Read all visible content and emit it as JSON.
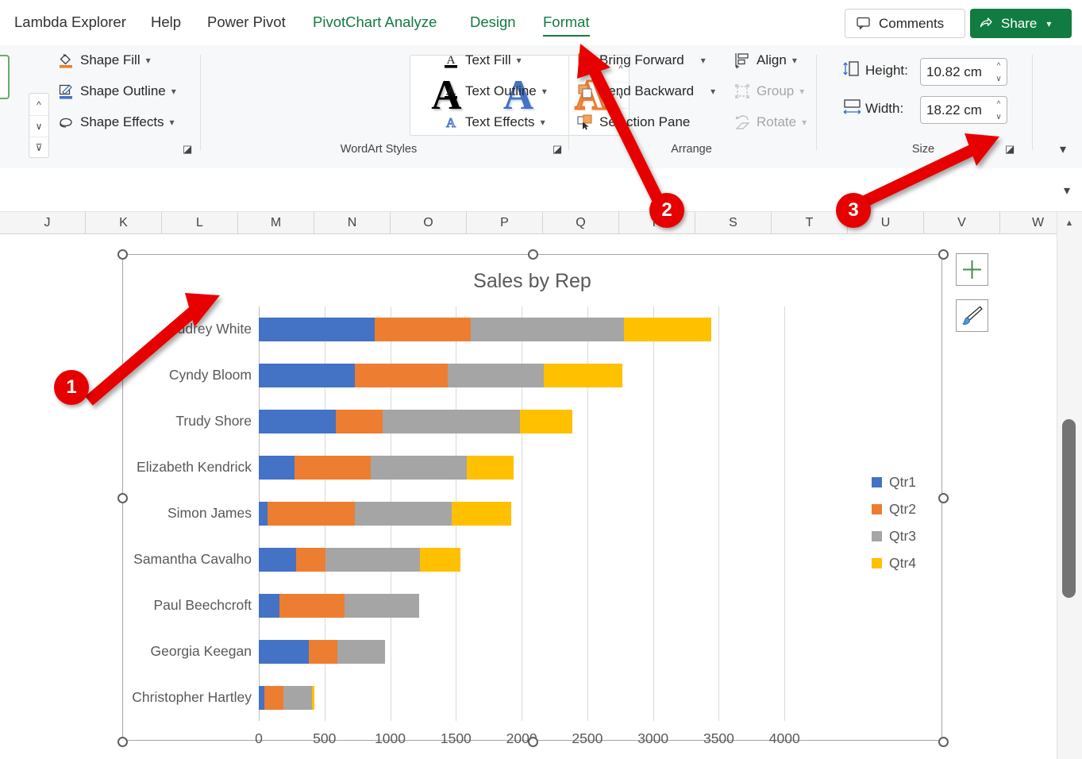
{
  "ribbon": {
    "tabs": [
      {
        "label": "Lambda Explorer",
        "style": "dark"
      },
      {
        "label": "Help",
        "style": "dark"
      },
      {
        "label": "Power Pivot",
        "style": "dark"
      },
      {
        "label": "PivotChart Analyze",
        "style": "green"
      },
      {
        "label": "Design",
        "style": "green"
      },
      {
        "label": "Format",
        "style": "active"
      }
    ],
    "comments_label": "Comments",
    "share_label": "Share",
    "groups": {
      "shape_styles": {
        "items": [
          {
            "label": "Shape Fill",
            "icon": "paint-bucket-icon",
            "chevron": "ˇ",
            "disabled": false
          },
          {
            "label": "Shape Outline",
            "icon": "pen-outline-icon",
            "chevron": "ˇ",
            "disabled": false
          },
          {
            "label": "Shape Effects",
            "icon": "shape-effects-icon",
            "chevron": "ˇ",
            "disabled": false
          }
        ]
      },
      "wordart": {
        "label": "WordArt Styles",
        "samples": [
          "A",
          "A",
          "A"
        ],
        "items": [
          {
            "label": "Text Fill",
            "icon": "text-fill-icon",
            "chevron": "ˇ"
          },
          {
            "label": "Text Outline",
            "icon": "text-outline-icon",
            "chevron": "ˇ"
          },
          {
            "label": "Text Effects",
            "icon": "text-effects-icon",
            "chevron": "ˇ"
          }
        ]
      },
      "arrange": {
        "label": "Arrange",
        "items": [
          {
            "label": "Bring Forward",
            "icon": "bring-forward-icon",
            "chevron": "ˇ",
            "disabled": false
          },
          {
            "label": "Send Backward",
            "icon": "send-backward-icon",
            "chevron": "ˇ",
            "disabled": false
          },
          {
            "label": "Selection Pane",
            "icon": "selection-pane-icon",
            "chevron": "",
            "disabled": false
          },
          {
            "label": "Align",
            "icon": "align-icon",
            "chevron": "ˇ",
            "disabled": false
          },
          {
            "label": "Group",
            "icon": "group-icon",
            "chevron": "ˇ",
            "disabled": true
          },
          {
            "label": "Rotate",
            "icon": "rotate-icon",
            "chevron": "ˇ",
            "disabled": true
          }
        ]
      },
      "size": {
        "label": "Size",
        "height_label": "Height:",
        "height_value": "10.82 cm",
        "width_label": "Width:",
        "width_value": "18.22 cm"
      }
    }
  },
  "grid": {
    "columns": [
      "J",
      "K",
      "L",
      "M",
      "N",
      "O",
      "P",
      "Q",
      "R",
      "S",
      "T",
      "U",
      "V",
      "W"
    ]
  },
  "chart_data": {
    "type": "bar",
    "orientation": "horizontal",
    "stacked": true,
    "title": "Sales by Rep",
    "xlabel": "",
    "ylabel": "",
    "xlim": [
      0,
      4500
    ],
    "xticks": [
      0,
      500,
      1000,
      1500,
      2000,
      2500,
      3000,
      3500,
      4000
    ],
    "xtick_labels": [
      "0",
      "500",
      "1000",
      "1500",
      "2000",
      "2500",
      "3000",
      "3500",
      "4000"
    ],
    "grid": true,
    "legend_position": "right",
    "categories": [
      "Audrey White",
      "Cyndy Bloom",
      "Trudy Shore",
      "Elizabeth Kendrick",
      "Simon James",
      "Samantha Cavalho",
      "Paul Beechcroft",
      "Georgia Keegan",
      "Christopher Hartley"
    ],
    "series": [
      {
        "name": "Qtr1",
        "color": "#4472c4",
        "values": [
          880,
          730,
          585,
          270,
          65,
          285,
          160,
          380,
          40
        ]
      },
      {
        "name": "Qtr2",
        "color": "#ed7d31",
        "values": [
          730,
          705,
          355,
          580,
          665,
          220,
          490,
          215,
          150
        ]
      },
      {
        "name": "Qtr3",
        "color": "#a5a5a5",
        "values": [
          1170,
          735,
          1050,
          730,
          740,
          720,
          570,
          365,
          215
        ]
      },
      {
        "name": "Qtr4",
        "color": "#ffc000",
        "values": [
          660,
          595,
          395,
          360,
          450,
          310,
          0,
          0,
          15
        ]
      }
    ]
  },
  "chart_buttons": {
    "elements": "chart-elements-button",
    "styles": "chart-styles-button"
  },
  "annotations": [
    {
      "number": "1"
    },
    {
      "number": "2"
    },
    {
      "number": "3"
    }
  ],
  "colors": {
    "accent_green": "#107c41",
    "annotation_red": "#e60000",
    "qtr1": "#4472c4",
    "qtr2": "#ed7d31",
    "qtr3": "#a5a5a5",
    "qtr4": "#ffc000"
  }
}
